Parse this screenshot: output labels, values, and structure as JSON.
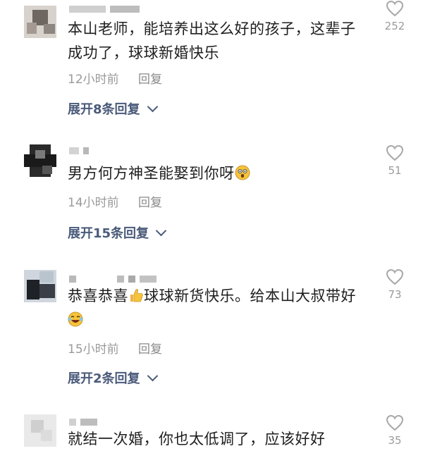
{
  "comments": [
    {
      "text": "本山老师，能培养出这么好的孩子，这辈子成功了，球球新婚快乐",
      "time": "12小时前",
      "reply": "回复",
      "expand": "展开8条回复",
      "likes": "252"
    },
    {
      "text": "男方何方神圣能娶到你呀",
      "emoji": "astonished-face",
      "time": "14小时前",
      "reply": "回复",
      "expand": "展开15条回复",
      "likes": "51"
    },
    {
      "text_a": "恭喜恭喜",
      "emoji_a": "thumbs-up",
      "text_b": "球球新货快乐。给本山大叔带好",
      "emoji_b": "laughing-tears-face",
      "time": "15小时前",
      "reply": "回复",
      "expand": "展开2条回复",
      "likes": "73"
    },
    {
      "text": "就结一次婚，你也太低调了，应该好好",
      "likes": "35"
    }
  ],
  "colors": {
    "link": "#4a5a7a",
    "meta": "#9a9a9a",
    "heart": "#a8a8a8"
  }
}
